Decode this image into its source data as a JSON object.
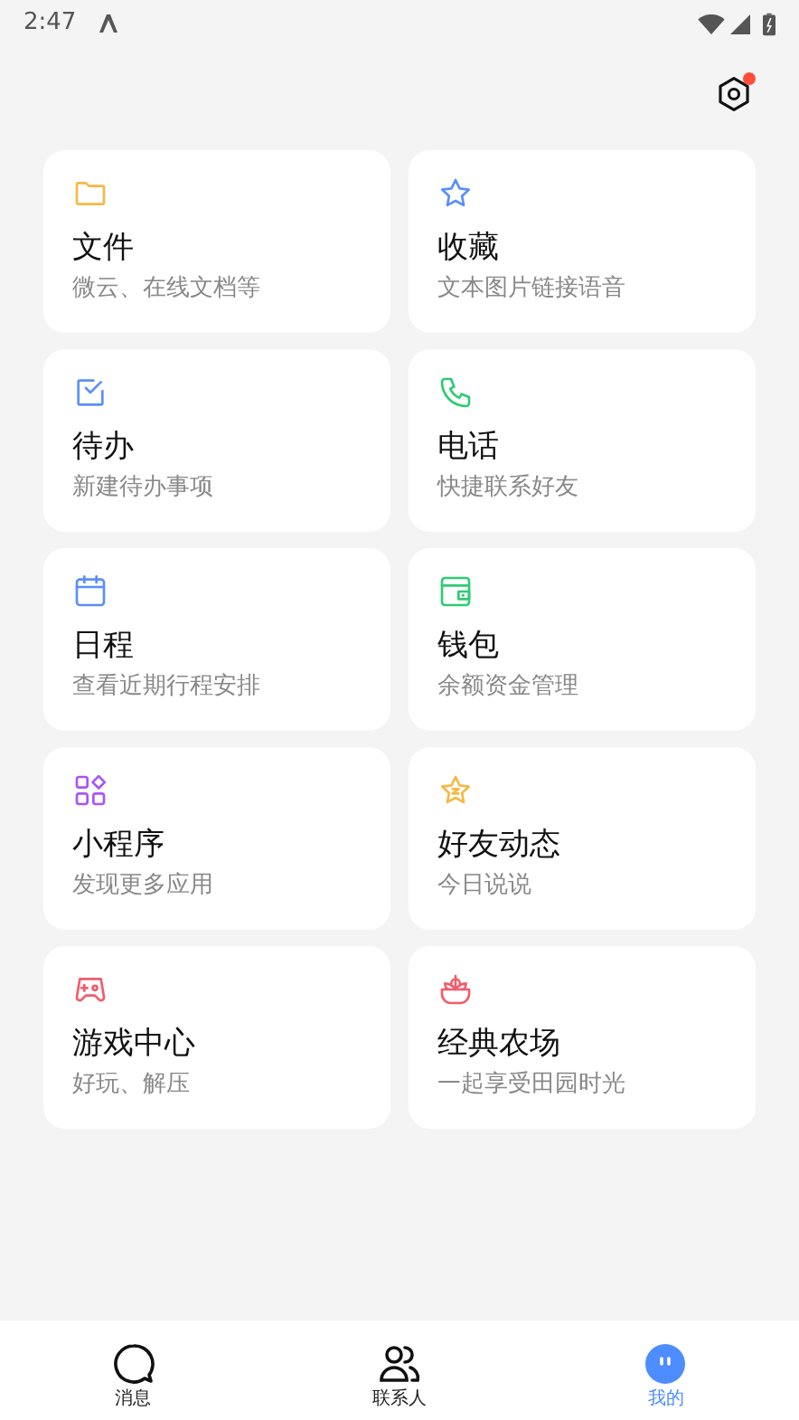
{
  "status_bar": {
    "time": "2:47"
  },
  "settings": {
    "badge": true
  },
  "cards": [
    {
      "kind": "folder",
      "color": "#f5b944",
      "title": "文件",
      "subtitle": "微云、在线文档等"
    },
    {
      "kind": "star",
      "color": "#5b8ff9",
      "title": "收藏",
      "subtitle": "文本图片链接语音"
    },
    {
      "kind": "todo",
      "color": "#5b8ff9",
      "title": "待办",
      "subtitle": "新建待办事项"
    },
    {
      "kind": "phone",
      "color": "#2ecc71",
      "title": "电话",
      "subtitle": "快捷联系好友"
    },
    {
      "kind": "calendar",
      "color": "#5b8ff9",
      "title": "日程",
      "subtitle": "查看近期行程安排"
    },
    {
      "kind": "wallet",
      "color": "#2ecc71",
      "title": "钱包",
      "subtitle": "余额资金管理"
    },
    {
      "kind": "apps",
      "color": "#a855f7",
      "title": "小程序",
      "subtitle": "发现更多应用"
    },
    {
      "kind": "moment",
      "color": "#f5b944",
      "title": "好友动态",
      "subtitle": "今日说说"
    },
    {
      "kind": "game",
      "color": "#f25c6b",
      "title": "游戏中心",
      "subtitle": "好玩、解压"
    },
    {
      "kind": "farm",
      "color": "#f25c6b",
      "title": "经典农场",
      "subtitle": "一起享受田园时光"
    }
  ],
  "nav": [
    {
      "kind": "chat",
      "label": "消息",
      "selected": false
    },
    {
      "kind": "contacts",
      "label": "联系人",
      "selected": false
    },
    {
      "kind": "me",
      "label": "我的",
      "selected": true
    }
  ]
}
